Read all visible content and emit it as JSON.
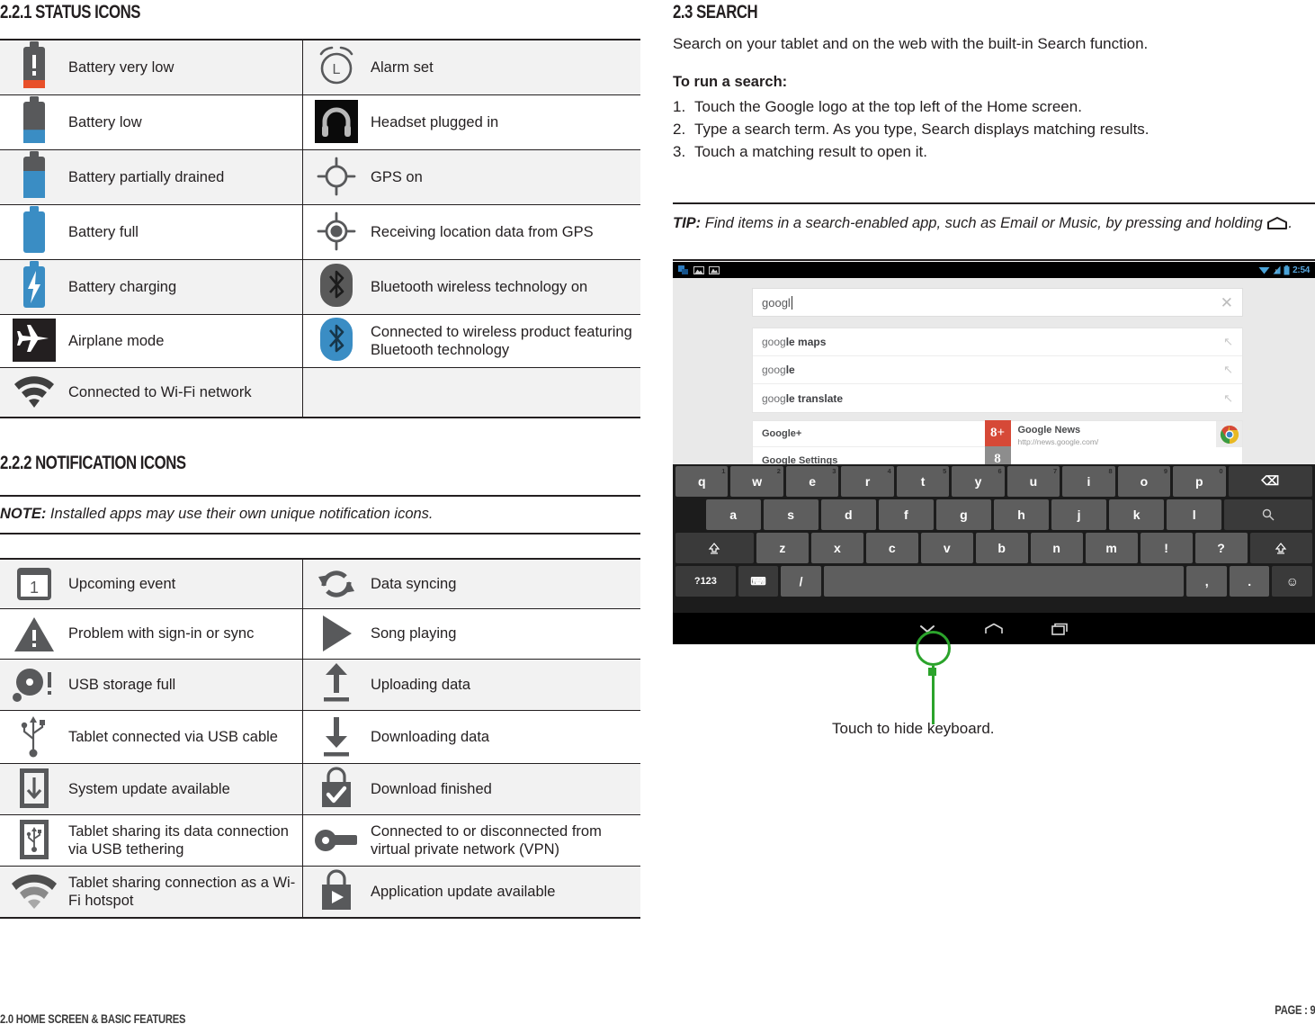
{
  "sections": {
    "status_icons_title": "2.2.1 STATUS ICONS",
    "notification_icons_title": "2.2.2 NOTIFICATION ICONS",
    "search_title": "2.3 SEARCH"
  },
  "note": {
    "prefix": "NOTE:",
    "text": " Installed apps may use their own unique notification icons."
  },
  "tip": {
    "prefix": "TIP:",
    "text_before": " Find items in a search-enabled app, such as Email or Music, by pressing and holding ",
    "text_after": "."
  },
  "status_icons": [
    {
      "left_icon": "battery-very-low-icon",
      "left_label": "Battery very low",
      "right_icon": "alarm-set-icon",
      "right_label": "Alarm set"
    },
    {
      "left_icon": "battery-low-icon",
      "left_label": "Battery low",
      "right_icon": "headset-icon",
      "right_label": "Headset plugged in"
    },
    {
      "left_icon": "battery-partial-icon",
      "left_label": "Battery partially drained",
      "right_icon": "gps-on-icon",
      "right_label": "GPS on"
    },
    {
      "left_icon": "battery-full-icon",
      "left_label": "Battery full",
      "right_icon": "gps-receiving-icon",
      "right_label": "Receiving location data from GPS"
    },
    {
      "left_icon": "battery-charging-icon",
      "left_label": "Battery charging",
      "right_icon": "bluetooth-on-icon",
      "right_label": "Bluetooth wireless technology on"
    },
    {
      "left_icon": "airplane-mode-icon",
      "left_label": "Airplane mode",
      "right_icon": "bluetooth-connected-icon",
      "right_label": "Connected to wireless product featuring Bluetooth technology"
    },
    {
      "left_icon": "wifi-connected-icon",
      "left_label": "Connected to Wi-Fi network",
      "right_icon": "",
      "right_label": ""
    }
  ],
  "notification_icons": [
    {
      "left_icon": "upcoming-event-icon",
      "left_label": "Upcoming event",
      "right_icon": "data-syncing-icon",
      "right_label": "Data syncing"
    },
    {
      "left_icon": "sign-in-problem-icon",
      "left_label": "Problem with sign-in or sync",
      "right_icon": "song-playing-icon",
      "right_label": "Song playing"
    },
    {
      "left_icon": "usb-storage-full-icon",
      "left_label": "USB storage full",
      "right_icon": "uploading-data-icon",
      "right_label": "Uploading data"
    },
    {
      "left_icon": "usb-connected-icon",
      "left_label": "Tablet connected via USB cable",
      "right_icon": "downloading-data-icon",
      "right_label": "Downloading data"
    },
    {
      "left_icon": "system-update-icon",
      "left_label": "System update available",
      "right_icon": "download-finished-icon",
      "right_label": "Download finished"
    },
    {
      "left_icon": "usb-tethering-icon",
      "left_label": "Tablet sharing its data connection via USB tethering",
      "right_icon": "vpn-icon",
      "right_label": "Connected to or disconnected from virtual private network (VPN)"
    },
    {
      "left_icon": "wifi-hotspot-icon",
      "left_label": "Tablet sharing connection as a Wi-Fi hotspot",
      "right_icon": "app-update-icon",
      "right_label": "Application update available"
    }
  ],
  "search": {
    "intro": "Search on your tablet and on the web with the built-in Search function.",
    "howto_title": "To run a search:",
    "steps": [
      {
        "num": "1.",
        "text": "Touch the Google logo at the top left of the Home screen."
      },
      {
        "num": "2.",
        "text": "Type a search term. As you type, Search displays matching results."
      },
      {
        "num": "3.",
        "text": "Touch a matching result to open it."
      }
    ]
  },
  "screenshot": {
    "statusbar": {
      "time": "2:54"
    },
    "search_box": {
      "value": "googl",
      "clear_icon": "close-icon"
    },
    "suggestions": [
      {
        "plain": "goog",
        "bold": "le maps"
      },
      {
        "plain": "goog",
        "bold": "le"
      },
      {
        "plain": "goog",
        "bold": "le translate"
      }
    ],
    "apps": [
      {
        "label": "Google+",
        "tile": "g-plus-icon",
        "tile_text": "8+"
      },
      {
        "label": "Google Settings",
        "tile": "g-settings-icon",
        "tile_text": "8"
      }
    ],
    "web_result": {
      "title": "Google News",
      "url": "http://news.google.com/",
      "icon": "chrome-icon"
    },
    "keyboard": {
      "row1": [
        {
          "key": "q",
          "alt": "1"
        },
        {
          "key": "w",
          "alt": "2"
        },
        {
          "key": "e",
          "alt": "3"
        },
        {
          "key": "r",
          "alt": "4"
        },
        {
          "key": "t",
          "alt": "5"
        },
        {
          "key": "y",
          "alt": "6"
        },
        {
          "key": "u",
          "alt": "7"
        },
        {
          "key": "i",
          "alt": "8"
        },
        {
          "key": "o",
          "alt": "9"
        },
        {
          "key": "p",
          "alt": "0"
        }
      ],
      "backspace": "⌫",
      "row2": [
        "a",
        "s",
        "d",
        "f",
        "g",
        "h",
        "j",
        "k",
        "l"
      ],
      "search_key": "search-icon",
      "row3": [
        "z",
        "x",
        "c",
        "v",
        "b",
        "n",
        "m",
        "!",
        "?"
      ],
      "shift_key": "shift-icon",
      "row4": {
        "symbols": "?123",
        "settings": "keyboard-settings-icon",
        "slash": "/",
        "space": "",
        "comma": ",",
        "period": ".",
        "emoji": "☺"
      }
    },
    "navbar": {
      "hide_keyboard": "hide-keyboard-icon",
      "home": "home-icon",
      "recents": "recents-icon"
    }
  },
  "callout": {
    "text": "Touch to hide keyboard."
  },
  "footer": {
    "left": "2.0 HOME SCREEN & BASIC FEATURES",
    "right": "PAGE : 9"
  },
  "colors": {
    "accent_blue": "#3a8dc4",
    "alert_orange": "#e8502a",
    "icon_gray": "#58595b",
    "callout_green": "#2ba32b"
  }
}
